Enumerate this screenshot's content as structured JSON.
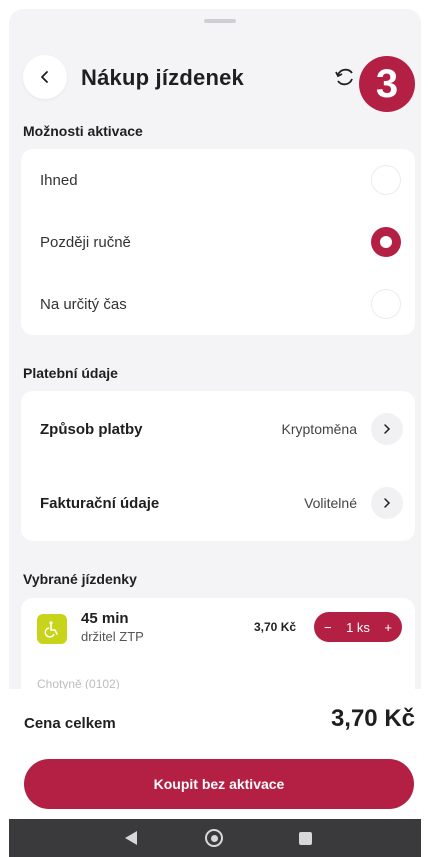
{
  "header": {
    "title": "Nákup jízdenek",
    "step_badge": "3"
  },
  "activation": {
    "section_title": "Možnosti aktivace",
    "options": [
      {
        "label": "Ihned",
        "selected": false
      },
      {
        "label": "Později ručně",
        "selected": true
      },
      {
        "label": "Na určitý čas",
        "selected": false
      }
    ]
  },
  "payment": {
    "section_title": "Platební údaje",
    "method_label": "Způsob platby",
    "method_value": "Kryptoměna",
    "billing_label": "Fakturační údaje",
    "billing_value": "Volitelné"
  },
  "tickets": {
    "section_title": "Vybrané jízdenky",
    "items": [
      {
        "icon": "wheelchair-icon",
        "name": "45 min",
        "subtitle": "držitel ZTP",
        "price": "3,70 Kč",
        "quantity_minus": "−",
        "quantity_label": "1 ks",
        "quantity_plus": "+"
      }
    ],
    "next_item_partial": "Chotyně (0102)"
  },
  "summary": {
    "total_label": "Cena celkem",
    "total_value": "3,70 Kč",
    "buy_button": "Koupit bez aktivace"
  },
  "colors": {
    "accent": "#b32043",
    "ticket_icon_bg": "#c8d419",
    "background": "#f4f4f6"
  }
}
